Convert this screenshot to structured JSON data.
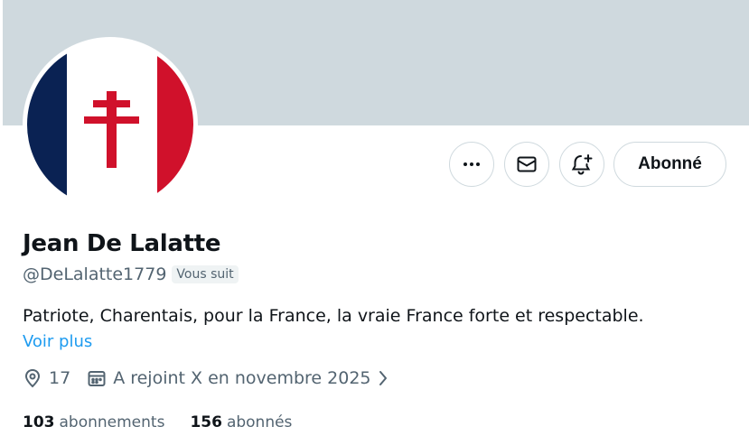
{
  "profile": {
    "name": "Jean De Lalatte",
    "handle": "@DeLalatte1779",
    "follows_you_badge": "Vous suit",
    "bio": "Patriote, Charentais, pour la France, la vraie France forte et respectable.",
    "see_more": "Voir plus",
    "location": "17",
    "joined": "A rejoint X en novembre 2025"
  },
  "actions": {
    "more_icon": "more-horizontal-icon",
    "message_icon": "envelope-icon",
    "notify_icon": "bell-plus-icon",
    "follow_label": "Abonné"
  },
  "stats": {
    "following_count": "103",
    "following_label": "abonnements",
    "followers_count": "156",
    "followers_label": "abonnés"
  },
  "colors": {
    "banner": "#cfd9de",
    "link": "#1d9bf0",
    "secondary_text": "#536471",
    "flag_blue": "#0a2253",
    "flag_red": "#d0112b"
  }
}
